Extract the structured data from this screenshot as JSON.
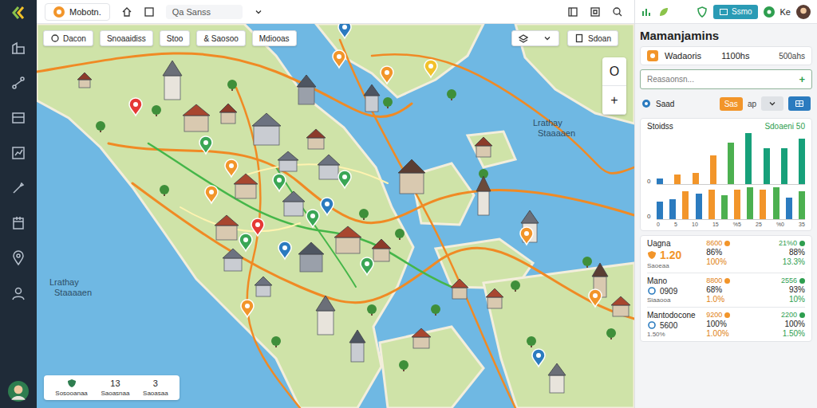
{
  "topbar": {
    "tab": "Mobotn.",
    "search": "Qa Sanss"
  },
  "map": {
    "filters": [
      "Dacon",
      "Snoaaidiss",
      "Stoo",
      "& Saosoo",
      "Mdiooas"
    ],
    "export_label": "Sdoan",
    "zoom": [
      "O",
      "+"
    ],
    "labels": [
      {
        "line1": "Lrathay",
        "line2": "Staaaaen"
      },
      {
        "line1": "Lrathay",
        "line2": "Staaaaen"
      }
    ],
    "pins": [
      {
        "color": "#e53935"
      },
      {
        "color": "#3aa655"
      },
      {
        "color": "#f2952a"
      },
      {
        "color": "#f2952a"
      },
      {
        "color": "#3aa655"
      },
      {
        "color": "#3aa655"
      },
      {
        "color": "#2b7bbf"
      },
      {
        "color": "#3aa655"
      },
      {
        "color": "#e53935"
      },
      {
        "color": "#3aa655"
      },
      {
        "color": "#2b7bbf"
      },
      {
        "color": "#3aa655"
      },
      {
        "color": "#f2952a"
      },
      {
        "color": "#f2c12a"
      },
      {
        "color": "#2b7bbf"
      },
      {
        "color": "#f2952a"
      },
      {
        "color": "#f2952a"
      },
      {
        "color": "#2b7bbf"
      },
      {
        "color": "#f2952a"
      },
      {
        "color": "#f2952a"
      }
    ],
    "legend": [
      {
        "value": "",
        "label": "Sosooanaa"
      },
      {
        "value": "13",
        "label": "Saoasnaa"
      },
      {
        "value": "3",
        "label": "Saoasaa"
      }
    ]
  },
  "panel": {
    "header": {
      "button": "Ssmo",
      "user": "Ke"
    },
    "title": "Mamanjamins",
    "summary": {
      "name": "Wadaoris",
      "value": "1100hs",
      "extra": "500ahs"
    },
    "input": {
      "placeholder": "Reasaonsn...",
      "button": "+"
    },
    "tools": {
      "label": "Saad",
      "orange_button": "Sas",
      "text": "ap"
    },
    "chart_card": {
      "title": "Stoidss",
      "note": "Sdoaeni 50",
      "charts": [
        {
          "y_tick": "0",
          "bars": [
            {
              "value": 6,
              "color": "#2b7bbf"
            },
            {
              "value": 10,
              "color": "#f2952a"
            },
            {
              "value": 12,
              "color": "#f2952a"
            },
            {
              "value": 30,
              "color": "#f2952a"
            },
            {
              "value": 44,
              "color": "#4cb050"
            },
            {
              "value": 54,
              "color": "#17a07a"
            },
            {
              "value": 38,
              "color": "#17a07a"
            },
            {
              "value": 38,
              "color": "#17a07a"
            },
            {
              "value": 48,
              "color": "#17a07a"
            }
          ],
          "x_labels": []
        },
        {
          "y_tick": "0",
          "bars": [
            {
              "value": 18,
              "color": "#2b7bbf"
            },
            {
              "value": 20,
              "color": "#2b7bbf"
            },
            {
              "value": 28,
              "color": "#f2952a"
            },
            {
              "value": 26,
              "color": "#2b7bbf"
            },
            {
              "value": 30,
              "color": "#f2952a"
            },
            {
              "value": 24,
              "color": "#4cb050"
            },
            {
              "value": 30,
              "color": "#f2952a"
            },
            {
              "value": 32,
              "color": "#4cb050"
            },
            {
              "value": 30,
              "color": "#f2952a"
            },
            {
              "value": 32,
              "color": "#4cb050"
            },
            {
              "value": 22,
              "color": "#2b7bbf"
            },
            {
              "value": 28,
              "color": "#4cb050"
            }
          ],
          "x_labels": [
            "0",
            "5",
            "10",
            "15",
            "%5",
            "25",
            "%0",
            "35"
          ]
        }
      ]
    },
    "stats": [
      {
        "kind": "featured",
        "name": "Uagna",
        "badge": "1.20",
        "sub": "Saoeaa",
        "head": [
          "8600",
          "21%0"
        ],
        "col1": [
          "86%",
          "100%"
        ],
        "col2": [
          "88%",
          "13.3%"
        ]
      },
      {
        "kind": "plain",
        "name": "Mano",
        "badge": "0909",
        "sub": "Siaaooa",
        "head": [
          "8800",
          "2556"
        ],
        "col1": [
          "68%",
          "1.0%"
        ],
        "col2": [
          "93%",
          "10%"
        ]
      },
      {
        "kind": "plain",
        "name": "Mantodocone",
        "badge": "5600",
        "sub": "1.50%",
        "head": [
          "9200",
          "2200"
        ],
        "col1": [
          "100%",
          "1.00%"
        ],
        "col2": [
          "100%",
          "1.50%"
        ]
      }
    ]
  }
}
